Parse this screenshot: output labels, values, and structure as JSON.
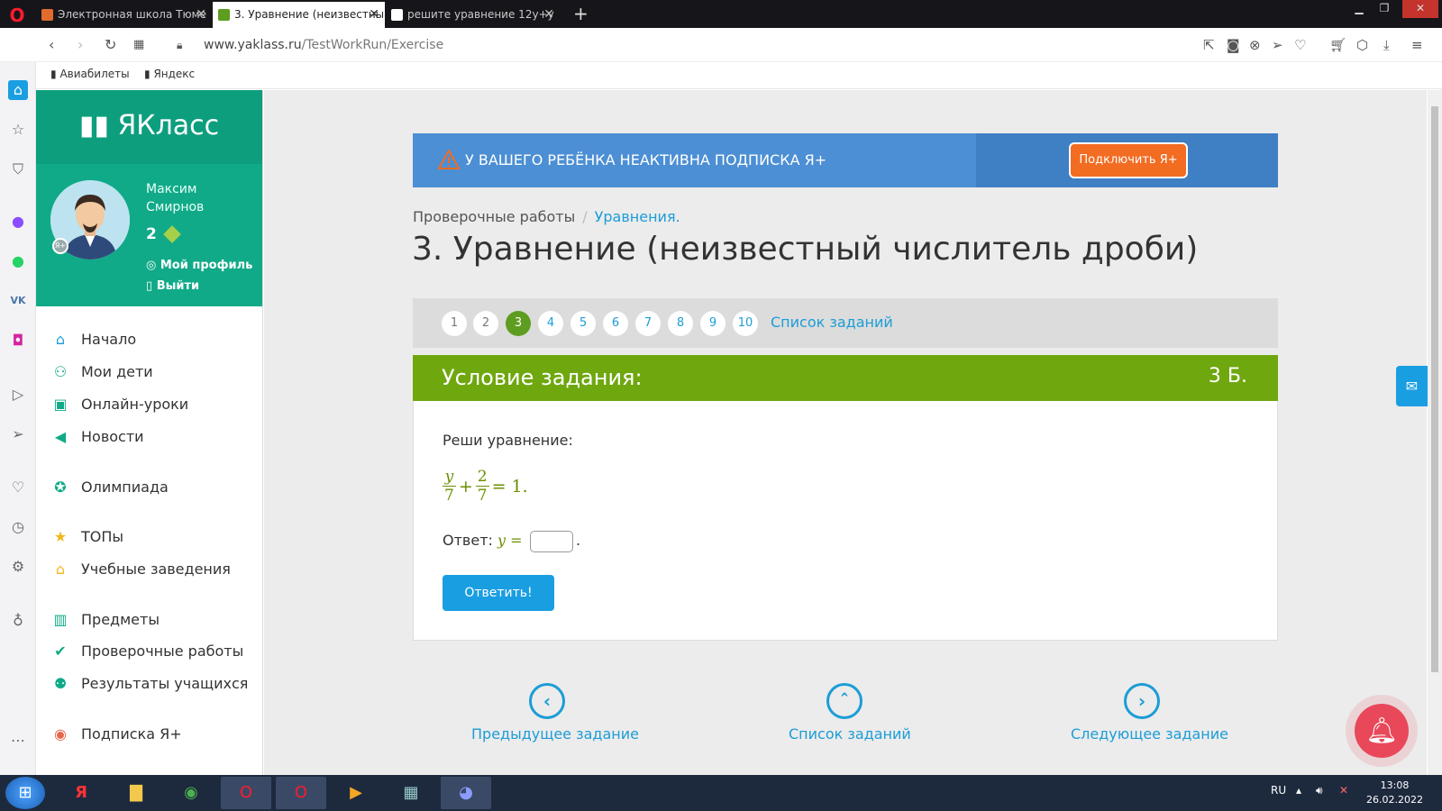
{
  "browser": {
    "tabs": [
      {
        "label": "Электронная школа Тюме",
        "favicon_color": "#e06b2c"
      },
      {
        "label": "3. Уравнение (неизвестны",
        "favicon_color": "#5d9d1f"
      },
      {
        "label": "решите уравнение 12y+y",
        "favicon_color": "#222222"
      }
    ],
    "url_domain": "www.yaklass.ru",
    "url_path": "/TestWorkRun/Exercise",
    "bookmarks": [
      "Авиабилеты",
      "Яндекс"
    ]
  },
  "sidebar": {
    "logo": "ЯКласс",
    "user_first": "Максим",
    "user_last": "Смирнов",
    "points": "2",
    "profile_link": "Мой профиль",
    "logout_link": "Выйти",
    "items": [
      {
        "label": "Начало",
        "icon": "home-icon"
      },
      {
        "label": "Мои дети",
        "icon": "children-icon"
      },
      {
        "label": "Онлайн-уроки",
        "icon": "video-icon"
      },
      {
        "label": "Новости",
        "icon": "megaphone-icon"
      },
      {
        "label": "Олимпиада",
        "icon": "medal-icon"
      },
      {
        "label": "ТОПы",
        "icon": "star-icon"
      },
      {
        "label": "Учебные заведения",
        "icon": "school-icon"
      },
      {
        "label": "Предметы",
        "icon": "book-icon"
      },
      {
        "label": "Проверочные работы",
        "icon": "check-circle-icon"
      },
      {
        "label": "Результаты учащихся",
        "icon": "users-icon"
      },
      {
        "label": "Подписка Я+",
        "icon": "subscription-icon"
      }
    ]
  },
  "banner": {
    "text": "У ВАШЕГО РЕБЁНКА НЕАКТИВНА ПОДПИСКА Я+",
    "button": "Подключить Я+"
  },
  "breadcrumb": {
    "parent": "Проверочные работы",
    "current": "Уравнения."
  },
  "page_title": "3. Уравнение (неизвестный числитель дроби)",
  "task_numbers": [
    "1",
    "2",
    "3",
    "4",
    "5",
    "6",
    "7",
    "8",
    "9",
    "10"
  ],
  "current_task": "3",
  "task_list_link": "Список заданий",
  "condition": {
    "header": "Условие задания:",
    "points": "3 Б.",
    "prompt": "Реши уравнение:",
    "eq": {
      "n1": "y",
      "d1": "7",
      "plus": "+",
      "n2": "2",
      "d2": "7",
      "rhs": "= 1."
    },
    "answer_label": "Ответ:",
    "answer_var": "y =",
    "answer_value": "",
    "answer_end": ".",
    "submit": "Ответить!"
  },
  "nav": {
    "prev": "Предыдущее задание",
    "list": "Список заданий",
    "next": "Следующее задание"
  },
  "taskbar": {
    "lang": "RU",
    "time": "13:08",
    "date": "26.02.2022"
  }
}
